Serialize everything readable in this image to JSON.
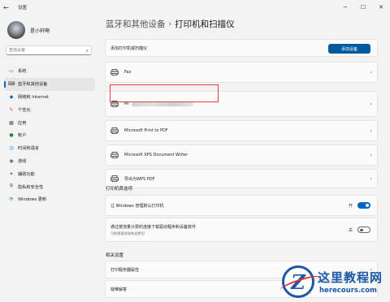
{
  "window": {
    "back_label": "←",
    "title": "设置",
    "controls": [
      "─",
      "☐",
      "✕"
    ]
  },
  "sidebar": {
    "user_name": "是小轩啊",
    "search_placeholder": "查找设置",
    "items": [
      {
        "label": "系统",
        "icon": "system-icon",
        "color": "#0078d4",
        "active": false
      },
      {
        "label": "蓝牙和其他设备",
        "icon": "bluetooth-devices-icon",
        "color": "#3a3a3a",
        "active": true
      },
      {
        "label": "网络和 Internet",
        "icon": "network-icon",
        "color": "#0067c0",
        "active": false
      },
      {
        "label": "个性化",
        "icon": "personalization-icon",
        "color": "#c25c1e",
        "active": false
      },
      {
        "label": "应用",
        "icon": "apps-icon",
        "color": "#4a5a6a",
        "active": false
      },
      {
        "label": "帐户",
        "icon": "accounts-icon",
        "color": "#1d8a3a",
        "active": false
      },
      {
        "label": "时间和语言",
        "icon": "time-language-icon",
        "color": "#0067c0",
        "active": false
      },
      {
        "label": "游戏",
        "icon": "gaming-icon",
        "color": "#5a5a5a",
        "active": false
      },
      {
        "label": "辅助功能",
        "icon": "accessibility-icon",
        "color": "#2a6ab0",
        "active": false
      },
      {
        "label": "隐私和安全性",
        "icon": "privacy-shield-icon",
        "color": "#5a5a5a",
        "active": false
      },
      {
        "label": "Windows 更新",
        "icon": "windows-update-icon",
        "color": "#0067c0",
        "active": false
      }
    ]
  },
  "main": {
    "breadcrumb_parent": "蓝牙和其他设备",
    "breadcrumb_sep": "›",
    "breadcrumb_current": "打印机和扫描仪",
    "add_row_label": "添加打印机或扫描仪",
    "add_button_label": "添加设备",
    "printers": [
      {
        "label": "Fax",
        "blurred": false
      },
      {
        "label": "Mi",
        "blurred": true
      },
      {
        "label": "Microsoft Print to PDF",
        "blurred": false
      },
      {
        "label": "Microsoft XPS Document Writer",
        "blurred": false
      },
      {
        "label": "导出为WPS PDF",
        "blurred": false
      }
    ],
    "prefs_title": "打印机首选项",
    "pref_default": {
      "label": "让 Windows 管理默认打印机",
      "state": "开"
    },
    "pref_metered": {
      "label": "通过按流量计费的连接下载驱动程序和设备软件",
      "sub": "可能需要收取数据费用",
      "state": "关"
    },
    "related_title": "相关设置",
    "related_items": [
      "打印服务器属性",
      "疑难解答"
    ]
  },
  "watermark": {
    "logo_letter": "Z",
    "cn": "这里教程网",
    "en": "herecours.com"
  },
  "colors": {
    "accent": "#0067c0",
    "button": "#005a9e",
    "highlight": "#e23c3c"
  }
}
